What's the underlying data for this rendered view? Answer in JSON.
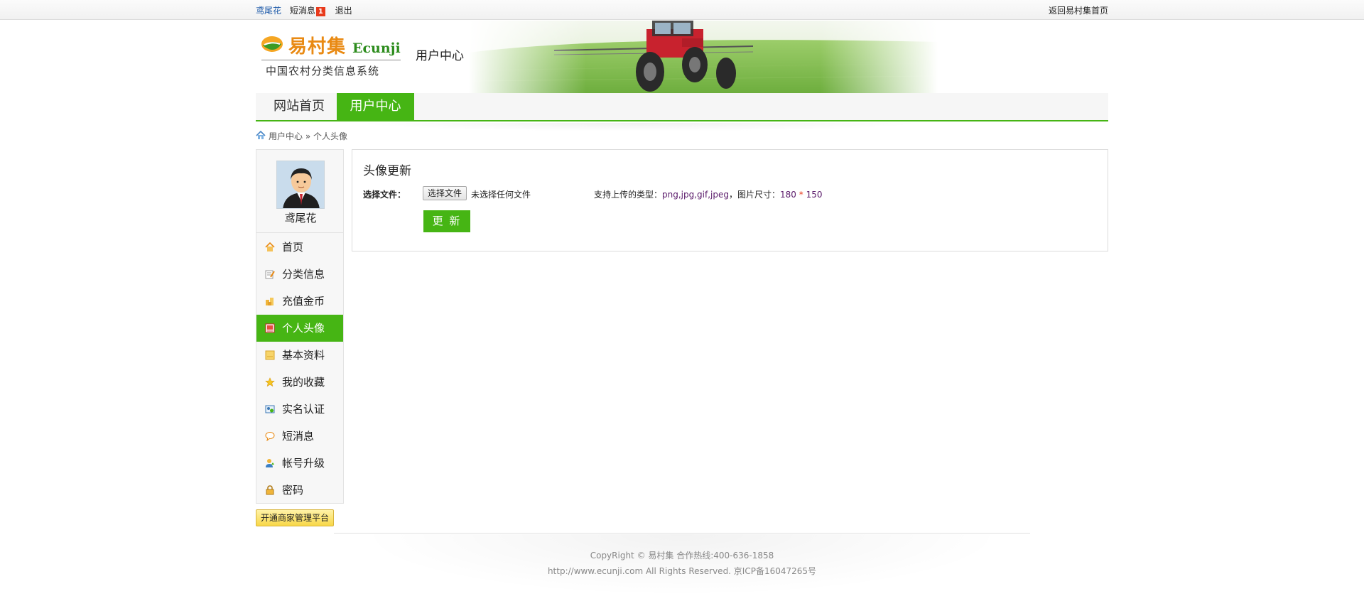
{
  "topbar": {
    "username": "鸢尾花",
    "messages_label": "短消息",
    "messages_count": "1",
    "logout": "退出",
    "home_link": "返回易村集首页"
  },
  "header": {
    "logo_cn": "易村集",
    "logo_en": "Ecunji",
    "logo_sub": "中国农村分类信息系统",
    "title": "用户中心"
  },
  "nav": {
    "tabs": [
      {
        "label": "网站首页",
        "active": false
      },
      {
        "label": "用户中心",
        "active": true
      }
    ]
  },
  "breadcrumb": {
    "items": [
      "用户中心",
      "个人头像"
    ],
    "text": "用户中心 » 个人头像"
  },
  "sidebar": {
    "username": "鸢尾花",
    "menu": [
      {
        "label": "首页",
        "icon": "home-icon",
        "active": false
      },
      {
        "label": "分类信息",
        "icon": "edit-note-icon",
        "active": false
      },
      {
        "label": "充值金币",
        "icon": "coins-icon",
        "active": false
      },
      {
        "label": "个人头像",
        "icon": "picture-icon",
        "active": true
      },
      {
        "label": "基本资料",
        "icon": "profile-card-icon",
        "active": false
      },
      {
        "label": "我的收藏",
        "icon": "star-icon",
        "active": false
      },
      {
        "label": "实名认证",
        "icon": "id-card-icon",
        "active": false
      },
      {
        "label": "短消息",
        "icon": "chat-bubble-icon",
        "active": false
      },
      {
        "label": "帐号升级",
        "icon": "user-upgrade-icon",
        "active": false
      },
      {
        "label": "密码",
        "icon": "lock-icon",
        "active": false
      }
    ],
    "biz_button": "开通商家管理平台"
  },
  "main": {
    "title": "头像更新",
    "file_label": "选择文件：",
    "file_button": "选择文件",
    "file_status": "未选择任何文件",
    "tip_prefix": "支持上传的类型：",
    "tip_types": "png,jpg,gif,jpeg",
    "tip_middle": "，图片尺寸：",
    "tip_width": "180",
    "tip_star": "*",
    "tip_height": "150",
    "submit": "更 新"
  },
  "footer": {
    "line1": "CopyRight © 易村集 合作热线:400-636-1858",
    "line2": "http://www.ecunji.com All Rights Reserved. 京ICP备16047265号"
  },
  "colors": {
    "accent_green": "#46b514",
    "badge_red": "#e83a1b",
    "logo_orange": "#e98a13",
    "logo_green": "#2d8c1d"
  }
}
